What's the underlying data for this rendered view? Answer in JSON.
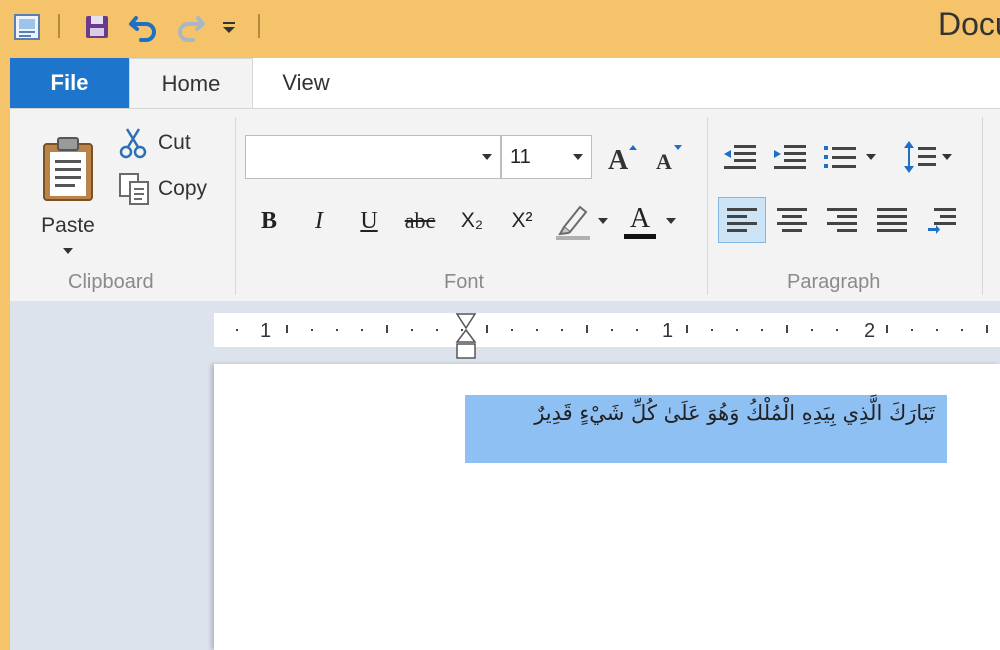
{
  "window": {
    "title": "Docu"
  },
  "quick_access": {
    "app_icon": "wordpad-app-icon",
    "save_icon": "save-icon",
    "undo_icon": "undo-icon",
    "redo_icon": "redo-icon",
    "customize_icon": "customize-toolbar-icon"
  },
  "tabs": [
    {
      "label": "File",
      "active": false
    },
    {
      "label": "Home",
      "active": true
    },
    {
      "label": "View",
      "active": false
    }
  ],
  "ribbon": {
    "clipboard": {
      "group_label": "Clipboard",
      "paste_label": "Paste",
      "cut_label": "Cut",
      "copy_label": "Copy"
    },
    "font": {
      "group_label": "Font",
      "font_family_value": "",
      "font_size_value": "11",
      "grow_icon": "grow-font-icon",
      "shrink_icon": "shrink-font-icon",
      "bold_label": "B",
      "italic_label": "I",
      "underline_label": "U",
      "strikethrough_label": "abc",
      "subscript_label": "X₂",
      "superscript_label": "X²",
      "text_color_label": "A"
    },
    "paragraph": {
      "group_label": "Paragraph"
    }
  },
  "ruler": {
    "labels": [
      "1",
      "1",
      "2"
    ]
  },
  "document": {
    "selected_text": "تَبَارَكَ الَّذِي بِيَدِهِ الْمُلْكُ وَهُوَ عَلَىٰ كُلِّ شَيْءٍ قَدِيرٌ"
  },
  "colors": {
    "titlebar": "#f5c46a",
    "file_tab": "#1e75cc",
    "ribbon": "#f3f3f3",
    "workspace": "#dde3ec",
    "selection": "#8fc0f4",
    "active_align": "#cde4f7"
  }
}
